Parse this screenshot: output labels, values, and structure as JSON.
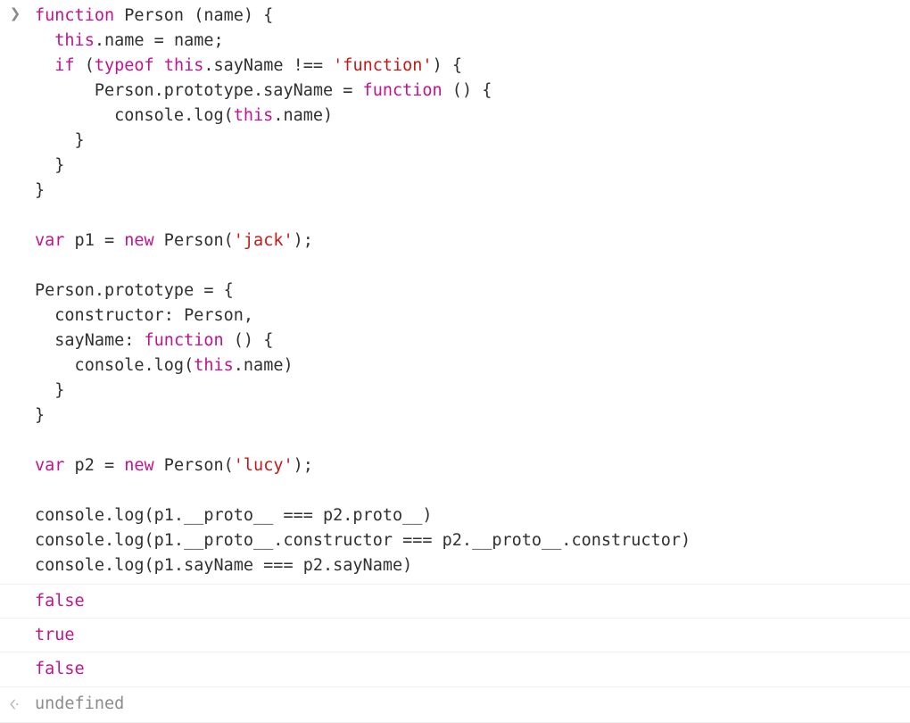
{
  "console": {
    "prompt_icon": "chevron-right-icon",
    "return_icon": "return-arrow-icon",
    "input": {
      "lines": [
        [
          {
            "t": "function",
            "c": "kw"
          },
          {
            "t": " Person (name) {",
            "c": "pln"
          }
        ],
        [
          {
            "t": "  ",
            "c": "pln"
          },
          {
            "t": "this",
            "c": "kw"
          },
          {
            "t": ".name = name;",
            "c": "pln"
          }
        ],
        [
          {
            "t": "  ",
            "c": "pln"
          },
          {
            "t": "if",
            "c": "kw"
          },
          {
            "t": " (",
            "c": "pln"
          },
          {
            "t": "typeof",
            "c": "kw"
          },
          {
            "t": " ",
            "c": "pln"
          },
          {
            "t": "this",
            "c": "kw"
          },
          {
            "t": ".sayName !== ",
            "c": "pln"
          },
          {
            "t": "'function'",
            "c": "str"
          },
          {
            "t": ") {",
            "c": "pln"
          }
        ],
        [
          {
            "t": "      Person.prototype.sayName = ",
            "c": "pln"
          },
          {
            "t": "function",
            "c": "kw"
          },
          {
            "t": " () {",
            "c": "pln"
          }
        ],
        [
          {
            "t": "        console.log(",
            "c": "pln"
          },
          {
            "t": "this",
            "c": "kw"
          },
          {
            "t": ".name)",
            "c": "pln"
          }
        ],
        [
          {
            "t": "    }",
            "c": "pln"
          }
        ],
        [
          {
            "t": "  }",
            "c": "pln"
          }
        ],
        [
          {
            "t": "}",
            "c": "pln"
          }
        ],
        [
          {
            "t": "",
            "c": "pln"
          }
        ],
        [
          {
            "t": "var",
            "c": "kw"
          },
          {
            "t": " p1 = ",
            "c": "pln"
          },
          {
            "t": "new",
            "c": "kw"
          },
          {
            "t": " Person(",
            "c": "pln"
          },
          {
            "t": "'jack'",
            "c": "str"
          },
          {
            "t": ");",
            "c": "pln"
          }
        ],
        [
          {
            "t": "",
            "c": "pln"
          }
        ],
        [
          {
            "t": "Person.prototype = {",
            "c": "pln"
          }
        ],
        [
          {
            "t": "  constructor: Person,",
            "c": "pln"
          }
        ],
        [
          {
            "t": "  sayName: ",
            "c": "pln"
          },
          {
            "t": "function",
            "c": "kw"
          },
          {
            "t": " () {",
            "c": "pln"
          }
        ],
        [
          {
            "t": "    console.log(",
            "c": "pln"
          },
          {
            "t": "this",
            "c": "kw"
          },
          {
            "t": ".name)",
            "c": "pln"
          }
        ],
        [
          {
            "t": "  }",
            "c": "pln"
          }
        ],
        [
          {
            "t": "}",
            "c": "pln"
          }
        ],
        [
          {
            "t": "",
            "c": "pln"
          }
        ],
        [
          {
            "t": "var",
            "c": "kw"
          },
          {
            "t": " p2 = ",
            "c": "pln"
          },
          {
            "t": "new",
            "c": "kw"
          },
          {
            "t": " Person(",
            "c": "pln"
          },
          {
            "t": "'lucy'",
            "c": "str"
          },
          {
            "t": ");",
            "c": "pln"
          }
        ],
        [
          {
            "t": "",
            "c": "pln"
          }
        ],
        [
          {
            "t": "console.log(p1.__proto__ === p2.proto__)",
            "c": "pln"
          }
        ],
        [
          {
            "t": "console.log(p1.__proto__.constructor === p2.__proto__.constructor)",
            "c": "pln"
          }
        ],
        [
          {
            "t": "console.log(p1.sayName === p2.sayName)",
            "c": "pln"
          }
        ]
      ]
    },
    "results": [
      {
        "text": "false",
        "kind": "log"
      },
      {
        "text": "true",
        "kind": "log"
      },
      {
        "text": "false",
        "kind": "log"
      },
      {
        "text": "undefined",
        "kind": "ret"
      }
    ]
  },
  "colors": {
    "keyword": "#c0158c",
    "string": "#c41a16",
    "plain": "#303030",
    "muted": "#8c8c8c",
    "rule": "#f0f0f0",
    "background": "#ffffff"
  }
}
